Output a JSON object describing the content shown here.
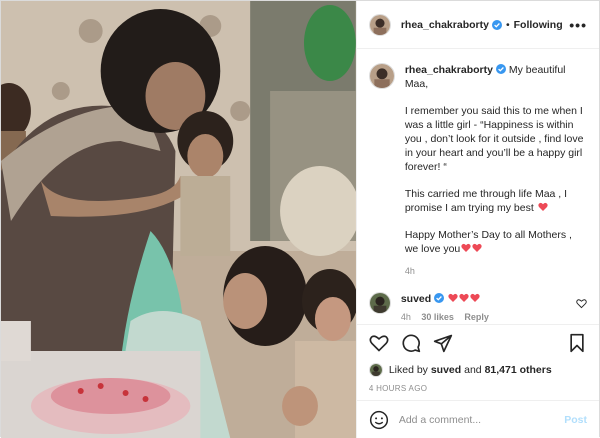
{
  "post": {
    "author": "rhea_chakraborty",
    "follow_status": "Following",
    "dot": "•",
    "more": "•••"
  },
  "caption": {
    "author": "rhea_chakraborty",
    "line1": "My beautiful Maa,",
    "para2": "I remember you said this to me when I was a little girl - “Happiness is within you , don’t look for it outside , find love in your heart and you’ll be a happy girl forever! “",
    "para3": "This carried me through life Maa , I promise I am trying my best",
    "para4": "Happy Mother’s Day to all Mothers , we love you",
    "time": "4h"
  },
  "comment": {
    "author": "suved",
    "time": "4h",
    "likes": "30 likes",
    "reply": "Reply"
  },
  "likes": {
    "prefix": "Liked by",
    "user": "suved",
    "and": "and",
    "count": "81,471 others"
  },
  "posted_time": "4 HOURS AGO",
  "add_comment": {
    "placeholder": "Add a comment...",
    "post": "Post"
  },
  "icons": {
    "like": "heart-icon",
    "comment": "comment-icon",
    "share": "share-icon",
    "save": "bookmark-icon",
    "emoji": "smiley-icon",
    "verified": "verified-badge-icon",
    "red_heart": "red-heart-emoji"
  },
  "colors": {
    "verified": "#3897f0",
    "heart": "#ed4956",
    "post_disabled": "#b2dffc",
    "muted": "#8e8e8e"
  }
}
